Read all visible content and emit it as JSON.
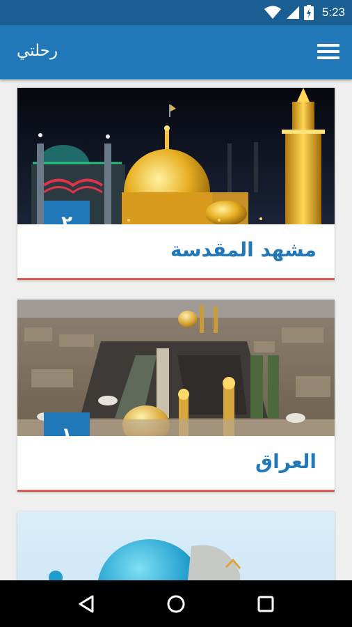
{
  "status_bar": {
    "time": "5:23",
    "icons": [
      "wifi-icon",
      "signal-icon",
      "battery-charging-icon"
    ]
  },
  "app_bar": {
    "title": "رحلتي",
    "menu_icon": "hamburger-menu-icon"
  },
  "cards": [
    {
      "badge": "٢",
      "title": "مشهد المقدسة",
      "image": "mashhad-shrine-night"
    },
    {
      "badge": "١",
      "title": "العراق",
      "image": "karbala-shrine-aerial"
    },
    {
      "badge": "",
      "title": "",
      "image": "blue-dome-sky"
    }
  ],
  "nav_bar": {
    "icons": [
      "back-icon",
      "home-icon",
      "recents-icon"
    ]
  },
  "colors": {
    "status_bar": "#1a5f93",
    "app_bar": "#2178b8",
    "accent": "#2178b8",
    "card_underline": "#e05a4e",
    "background": "#efefef"
  }
}
